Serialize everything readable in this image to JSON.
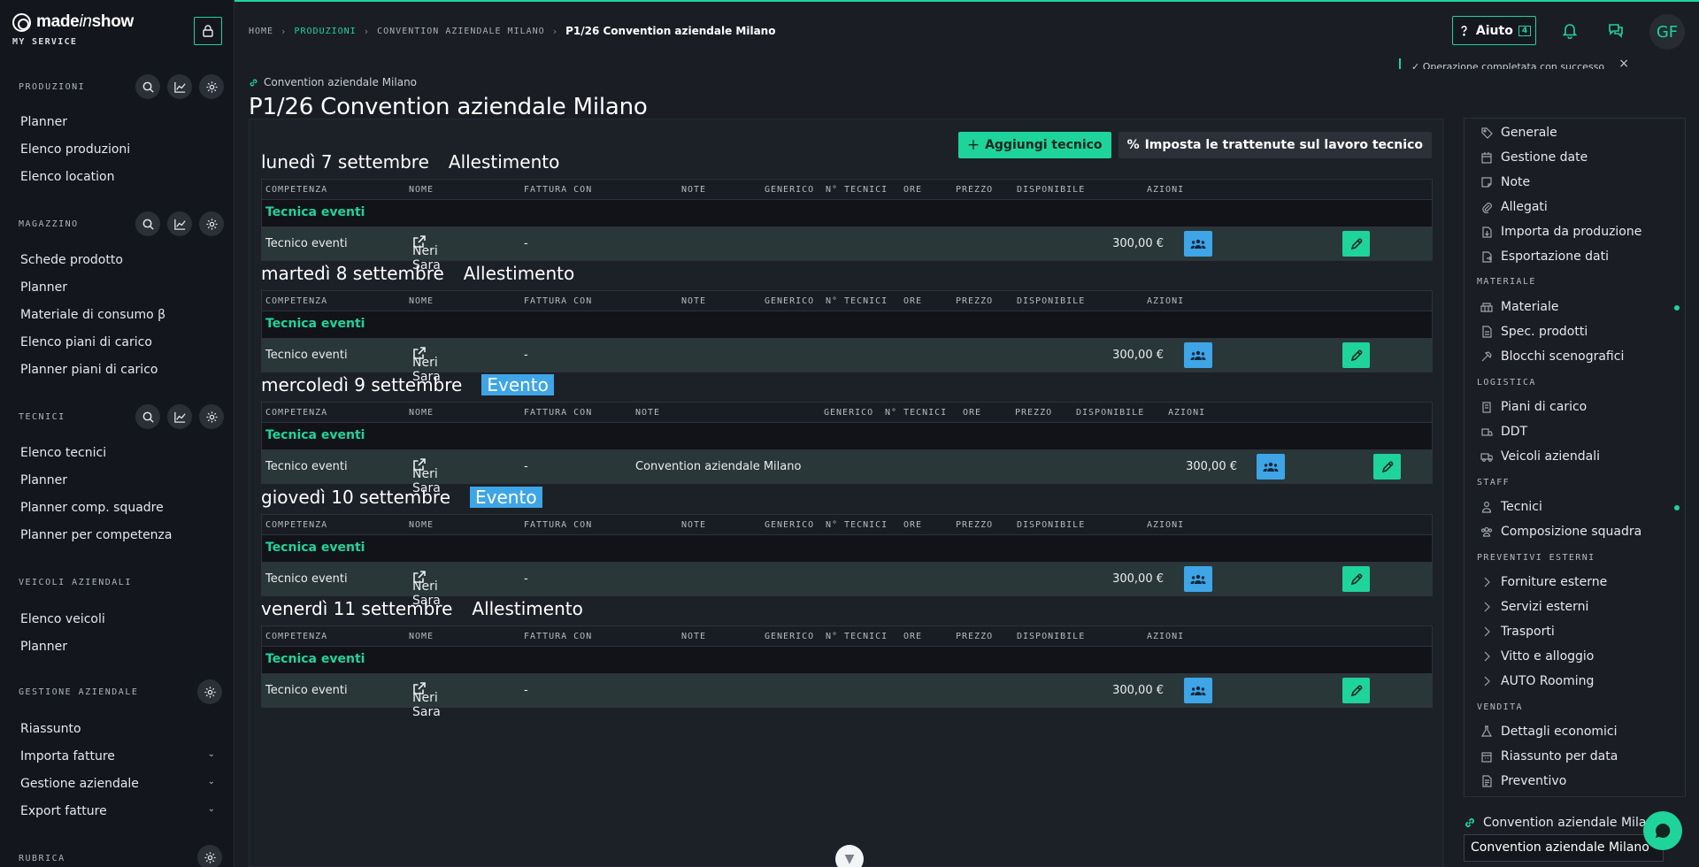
{
  "brand": {
    "name_main": "made",
    "name_italic": "in",
    "name_end": "show",
    "sub": "MY SERVICE"
  },
  "sidebar": {
    "sections": [
      {
        "head": "PRODUZIONI",
        "items": [
          "Planner",
          "Elenco produzioni",
          "Elenco location"
        ]
      },
      {
        "head": "MAGAZZINO",
        "items": [
          "Schede prodotto",
          "Planner",
          "Materiale di consumo β",
          "Elenco piani di carico",
          "Planner piani di carico"
        ]
      },
      {
        "head": "TECNICI",
        "items": [
          "Elenco tecnici",
          "Planner",
          "Planner comp. squadre",
          "Planner per competenza"
        ]
      },
      {
        "head": "VEICOLI AZIENDALI",
        "items": [
          "Elenco veicoli",
          "Planner"
        ]
      },
      {
        "head": "GESTIONE AZIENDALE",
        "items": [
          "Riassunto",
          "Importa fatture",
          "Gestione aziendale",
          "Export fatture"
        ]
      },
      {
        "head": "RUBRICA",
        "items": []
      }
    ]
  },
  "breadcrumb": [
    "HOME",
    "PRODUZIONI",
    "CONVENTION AZIENDALE MILANO",
    "P1/26 Convention aziendale Milano"
  ],
  "header": {
    "help_label": "Aiuto",
    "help_badge": "4",
    "avatar": "GF",
    "toast": "✓ Operazione completata con successo"
  },
  "page": {
    "link_label": "Convention aziendale Milano",
    "title": "P1/26 Convention aziendale Milano"
  },
  "actions": {
    "add_tech": "Aggiungi tecnico",
    "set_withholding": "Imposta le trattenute sul lavoro tecnico"
  },
  "columns": [
    "COMPETENZA",
    "NOME",
    "FATTURA CON",
    "NOTE",
    "GENERICO",
    "N° TECNICI",
    "ORE",
    "PREZZO",
    "DISPONIBILE",
    "AZIONI"
  ],
  "days": [
    {
      "date": "lunedì 7 settembre",
      "phase": "Allestimento",
      "group": "Tecnica eventi",
      "row": {
        "competenza": "Tecnico eventi",
        "nome": "Neri Sara",
        "fattura": "-",
        "note": "",
        "prezzo": "300,00 €"
      }
    },
    {
      "date": "martedì 8 settembre",
      "phase": "Allestimento",
      "group": "Tecnica eventi",
      "row": {
        "competenza": "Tecnico eventi",
        "nome": "Neri Sara",
        "fattura": "-",
        "note": "",
        "prezzo": "300,00 €"
      }
    },
    {
      "date": "mercoledì 9 settembre",
      "phase": "Evento",
      "group": "Tecnica eventi",
      "row": {
        "competenza": "Tecnico eventi",
        "nome": "Neri Sara",
        "fattura": "-",
        "note": "Convention aziendale Milano",
        "prezzo": "300,00 €"
      }
    },
    {
      "date": "giovedì 10 settembre",
      "phase": "Evento",
      "group": "Tecnica eventi",
      "row": {
        "competenza": "Tecnico eventi",
        "nome": "Neri Sara",
        "fattura": "-",
        "note": "",
        "prezzo": "300,00 €"
      }
    },
    {
      "date": "venerdì 11 settembre",
      "phase": "Allestimento",
      "group": "Tecnica eventi",
      "row": {
        "competenza": "Tecnico eventi",
        "nome": "Neri Sara",
        "fattura": "-",
        "note": "",
        "prezzo": "300,00 €"
      }
    }
  ],
  "right_menu": {
    "top": [
      "Generale",
      "Gestione date",
      "Note",
      "Allegati",
      "Importa da produzione",
      "Esportazione dati"
    ],
    "materiale_head": "MATERIALE",
    "materiale": [
      "Materiale",
      "Spec. prodotti",
      "Blocchi scenografici"
    ],
    "logistica_head": "LOGISTICA",
    "logistica": [
      "Piani di carico",
      "DDT",
      "Veicoli aziendali"
    ],
    "staff_head": "STAFF",
    "staff": [
      "Tecnici",
      "Composizione squadra"
    ],
    "preventivi_head": "PREVENTIVI ESTERNI",
    "preventivi": [
      "Forniture esterne",
      "Servizi esterni",
      "Trasporti",
      "Vitto e alloggio",
      "AUTO Rooming"
    ],
    "vendita_head": "VENDITA",
    "vendita": [
      "Dettagli economici",
      "Riassunto per data",
      "Preventivo"
    ]
  },
  "bottom_right": {
    "link_label": "Convention aziendale Milano",
    "select_value": "Convention aziendale Milano"
  }
}
